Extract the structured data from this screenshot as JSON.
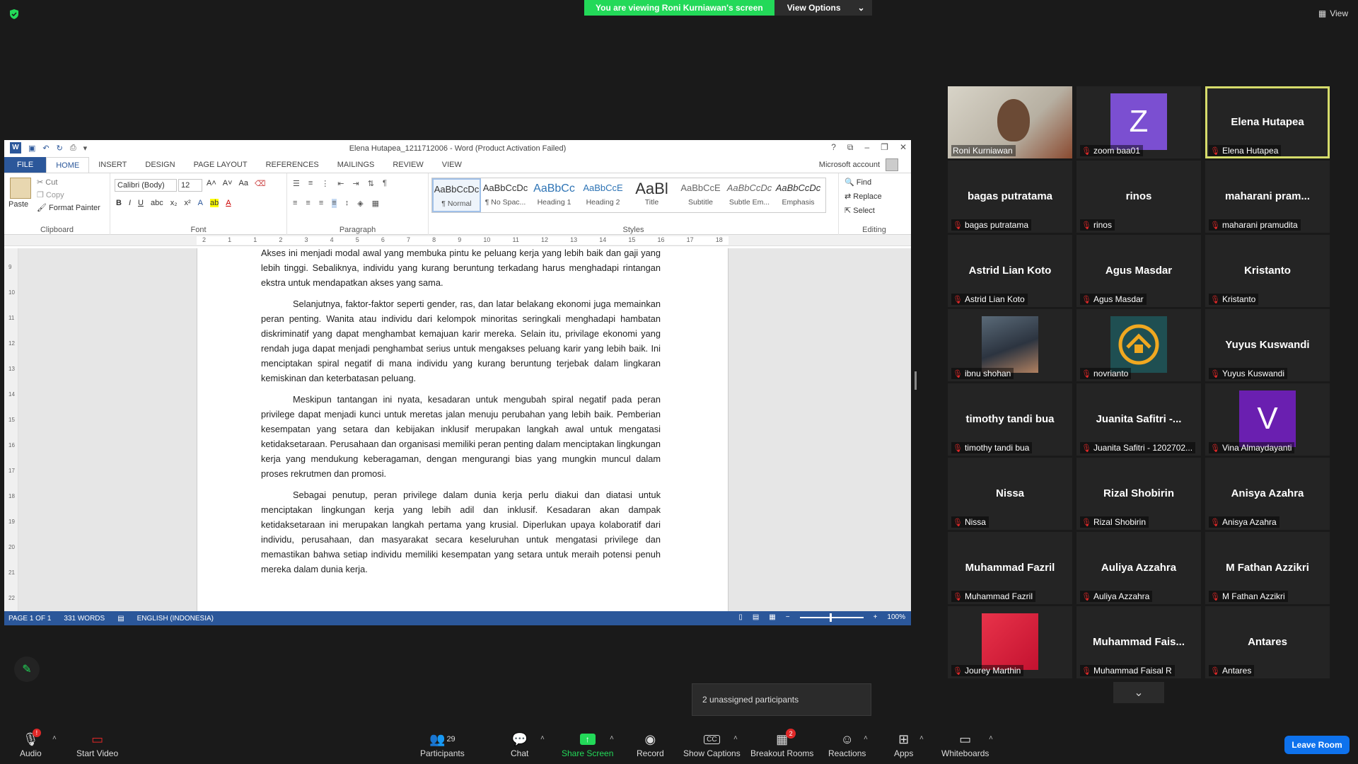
{
  "banner": {
    "viewing": "You are viewing Roni Kurniawan's screen",
    "view_options": "View Options"
  },
  "view_button": "View",
  "word": {
    "title": "Elena Hutapea_1211712006 - Word (Product Activation Failed)",
    "tabs": [
      "FILE",
      "HOME",
      "INSERT",
      "DESIGN",
      "PAGE LAYOUT",
      "REFERENCES",
      "MAILINGS",
      "REVIEW",
      "VIEW"
    ],
    "account": "Microsoft account",
    "clipboard": {
      "paste": "Paste",
      "cut": "Cut",
      "copy": "Copy",
      "format_painter": "Format Painter",
      "label": "Clipboard"
    },
    "font": {
      "name": "Calibri (Body)",
      "size": "12",
      "label": "Font"
    },
    "paragraph_label": "Paragraph",
    "styles": [
      {
        "prev": "AaBbCcDc",
        "name": "¶ Normal"
      },
      {
        "prev": "AaBbCcDc",
        "name": "¶ No Spac..."
      },
      {
        "prev": "AaBbCc",
        "name": "Heading 1"
      },
      {
        "prev": "AaBbCcE",
        "name": "Heading 2"
      },
      {
        "prev": "AaBl",
        "name": "Title"
      },
      {
        "prev": "AaBbCcE",
        "name": "Subtitle"
      },
      {
        "prev": "AaBbCcDc",
        "name": "Subtle Em..."
      },
      {
        "prev": "AaBbCcDc",
        "name": "Emphasis"
      }
    ],
    "styles_label": "Styles",
    "editing": {
      "find": "Find",
      "replace": "Replace",
      "select": "Select",
      "label": "Editing"
    },
    "ruler": [
      "2",
      "1",
      "1",
      "2",
      "3",
      "4",
      "5",
      "6",
      "7",
      "8",
      "9",
      "10",
      "11",
      "12",
      "13",
      "14",
      "15",
      "16",
      "17",
      "18"
    ],
    "vruler": [
      "9",
      "10",
      "11",
      "12",
      "13",
      "14",
      "15",
      "16",
      "17",
      "18",
      "19",
      "20",
      "21",
      "22"
    ],
    "paragraphs": [
      "Akses ini menjadi modal awal yang membuka pintu ke peluang kerja yang lebih baik dan gaji yang lebih tinggi. Sebaliknya, individu yang kurang beruntung terkadang harus menghadapi rintangan ekstra untuk mendapatkan akses yang sama.",
      "Selanjutnya, faktor-faktor seperti gender, ras, dan latar belakang ekonomi juga memainkan peran penting. Wanita atau individu dari kelompok minoritas seringkali menghadapi hambatan diskriminatif yang dapat menghambat kemajuan karir mereka. Selain itu, privilage ekonomi yang rendah juga dapat menjadi penghambat serius untuk mengakses peluang karir yang lebih baik. Ini menciptakan spiral negatif di mana individu yang kurang beruntung terjebak dalam lingkaran kemiskinan dan keterbatasan peluang.",
      "Meskipun tantangan ini nyata, kesadaran untuk mengubah spiral negatif pada peran privilege dapat menjadi kunci untuk meretas jalan menuju perubahan yang lebih baik. Pemberian kesempatan yang setara dan kebijakan inklusif merupakan langkah awal untuk mengatasi ketidaksetaraan. Perusahaan dan organisasi memiliki peran penting dalam menciptakan lingkungan kerja yang mendukung keberagaman, dengan mengurangi bias yang mungkin muncul dalam proses rekrutmen dan promosi.",
      "Sebagai penutup, peran privilege dalam dunia kerja perlu diakui dan diatasi untuk menciptakan lingkungan kerja yang lebih adil dan inklusif. Kesadaran akan dampak ketidaksetaraan ini merupakan langkah pertama yang krusial. Diperlukan upaya kolaboratif dari individu, perusahaan, dan masyarakat secara keseluruhan untuk mengatasi privilege dan memastikan bahwa setiap individu memiliki kesempatan yang setara untuk meraih potensi penuh mereka dalam dunia kerja."
    ],
    "status": {
      "page": "PAGE 1 OF 1",
      "words": "331 WORDS",
      "lang": "ENGLISH (INDONESIA)",
      "zoom": "100%"
    }
  },
  "participants": [
    {
      "big": "",
      "label": "Roni Kurniawan",
      "kind": "video"
    },
    {
      "big": "Z",
      "label": "zoom baa01",
      "kind": "avatar",
      "color": "#7b4fd1"
    },
    {
      "big": "Elena Hutapea",
      "label": "Elena Hutapea",
      "kind": "name",
      "active": true
    },
    {
      "big": "bagas putratama",
      "label": "bagas putratama",
      "kind": "name"
    },
    {
      "big": "rinos",
      "label": "rinos",
      "kind": "name"
    },
    {
      "big": "maharani  pram...",
      "label": "maharani pramudita",
      "kind": "name"
    },
    {
      "big": "Astrid Lian Koto",
      "label": "Astrid Lian Koto",
      "kind": "name"
    },
    {
      "big": "Agus Masdar",
      "label": "Agus Masdar",
      "kind": "name"
    },
    {
      "big": "Kristanto",
      "label": "Kristanto",
      "kind": "name"
    },
    {
      "big": "",
      "label": "ibnu shohan",
      "kind": "photo"
    },
    {
      "big": "",
      "label": "novrianto",
      "kind": "logo"
    },
    {
      "big": "Yuyus Kuswandi",
      "label": "Yuyus Kuswandi",
      "kind": "name"
    },
    {
      "big": "timothy tandi bua",
      "label": "timothy tandi bua",
      "kind": "name"
    },
    {
      "big": "Juanita  Safitri -...",
      "label": "Juanita Safitri - 1202702...",
      "kind": "name"
    },
    {
      "big": "V",
      "label": "Vina Almaydayanti",
      "kind": "avatar",
      "color": "#6a1fb0"
    },
    {
      "big": "Nissa",
      "label": "Nissa",
      "kind": "name"
    },
    {
      "big": "Rizal Shobirin",
      "label": "Rizal Shobirin",
      "kind": "name"
    },
    {
      "big": "Anisya Azahra",
      "label": "Anisya Azahra",
      "kind": "name"
    },
    {
      "big": "Muhammad Fazril",
      "label": "Muhammad Fazril",
      "kind": "name"
    },
    {
      "big": "Auliya Azzahra",
      "label": "Auliya Azzahra",
      "kind": "name"
    },
    {
      "big": "M Fathan Azzikri",
      "label": "M Fathan Azzikri",
      "kind": "name"
    },
    {
      "big": "",
      "label": "Jourey Marthin",
      "kind": "red"
    },
    {
      "big": "Muhammad  Fais...",
      "label": "Muhammad Faisal R",
      "kind": "name"
    },
    {
      "big": "Antares",
      "label": "Antares",
      "kind": "name"
    }
  ],
  "unassigned": "2 unassigned participants",
  "toolbar": {
    "audio": "Audio",
    "video": "Start Video",
    "participants": "Participants",
    "participants_count": "29",
    "chat": "Chat",
    "share": "Share Screen",
    "record": "Record",
    "captions": "Show Captions",
    "breakout": "Breakout Rooms",
    "breakout_badge": "2",
    "reactions": "Reactions",
    "apps": "Apps",
    "whiteboards": "Whiteboards",
    "leave": "Leave Room",
    "audio_badge": "!"
  },
  "colors": {
    "share_green": "#23d959",
    "word_blue": "#2b579a",
    "leave_blue": "#0e72ed",
    "active_outline": "#d6dc6b"
  }
}
